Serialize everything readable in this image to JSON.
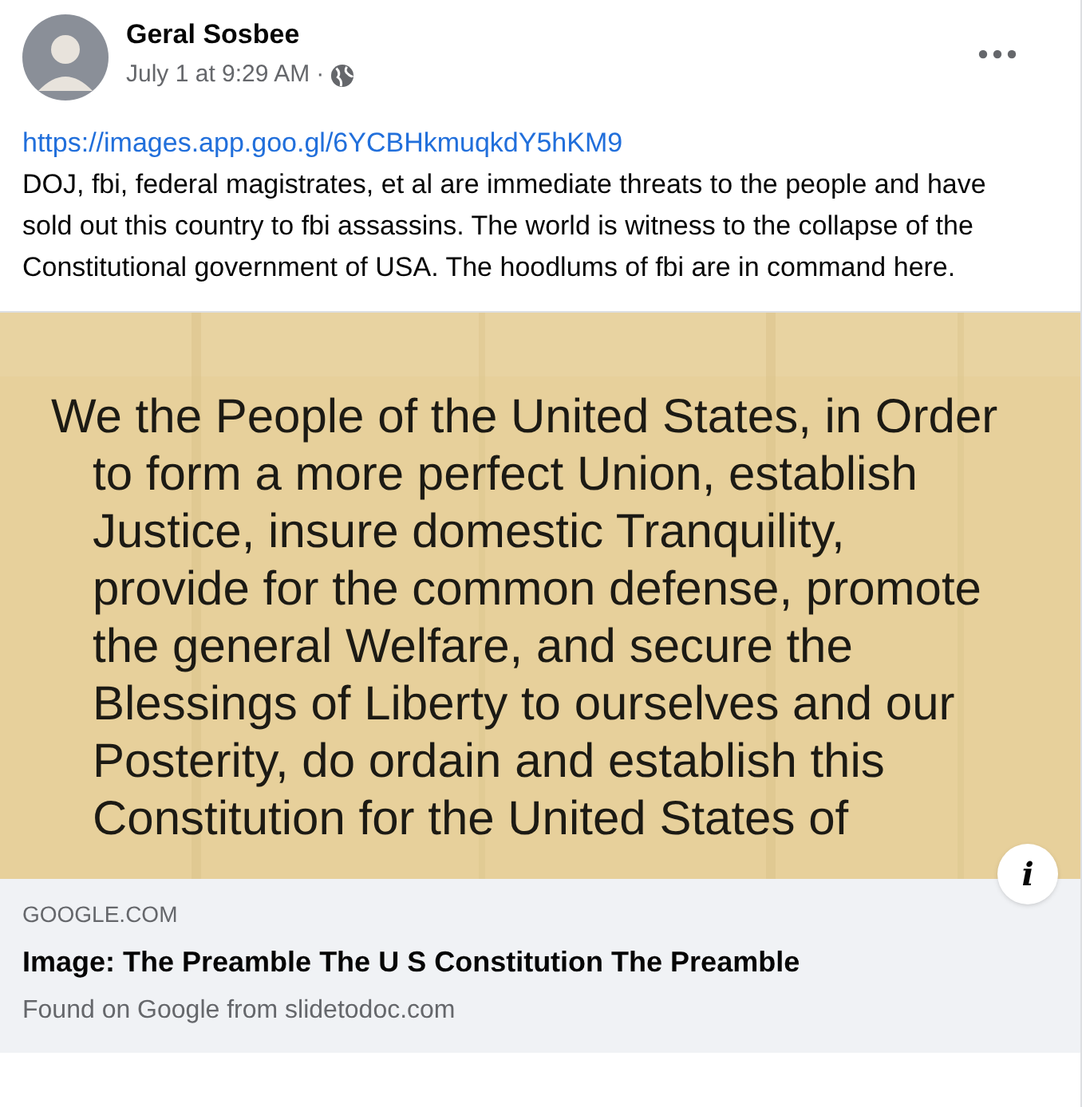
{
  "post": {
    "author": "Geral Sosbee",
    "time": "July 1 at 9:29 AM",
    "separator": "·",
    "link": "https://images.app.goo.gl/6YCBHkmuqkdY5hKM9",
    "text": "DOJ, fbi, federal magistrates, et al are immediate threats to the people and have sold out this country to fbi assassins. The world is witness to the collapse of the Constitutional government of USA. The hoodlums of fbi are in command here."
  },
  "preview": {
    "image_lines": [
      {
        "kind": "first",
        "text": "We the People of the United States, in Order"
      },
      {
        "kind": "indent",
        "text": "to form a more perfect Union, establish"
      },
      {
        "kind": "indent",
        "text": "Justice, insure domestic Tranquility,"
      },
      {
        "kind": "indent",
        "text": "provide for the common defense, promote"
      },
      {
        "kind": "indent",
        "text": "the general Welfare, and secure the"
      },
      {
        "kind": "indent",
        "text": "Blessings of Liberty to ourselves and our"
      },
      {
        "kind": "indent",
        "text": "Posterity, do ordain and establish this"
      },
      {
        "kind": "indent",
        "text": "Constitution for the United States of"
      }
    ],
    "info_button": "i",
    "domain": "GOOGLE.COM",
    "title": "Image: The Preamble The U S Constitution The Preamble",
    "subtitle": "Found on Google from slidetodoc.com"
  }
}
